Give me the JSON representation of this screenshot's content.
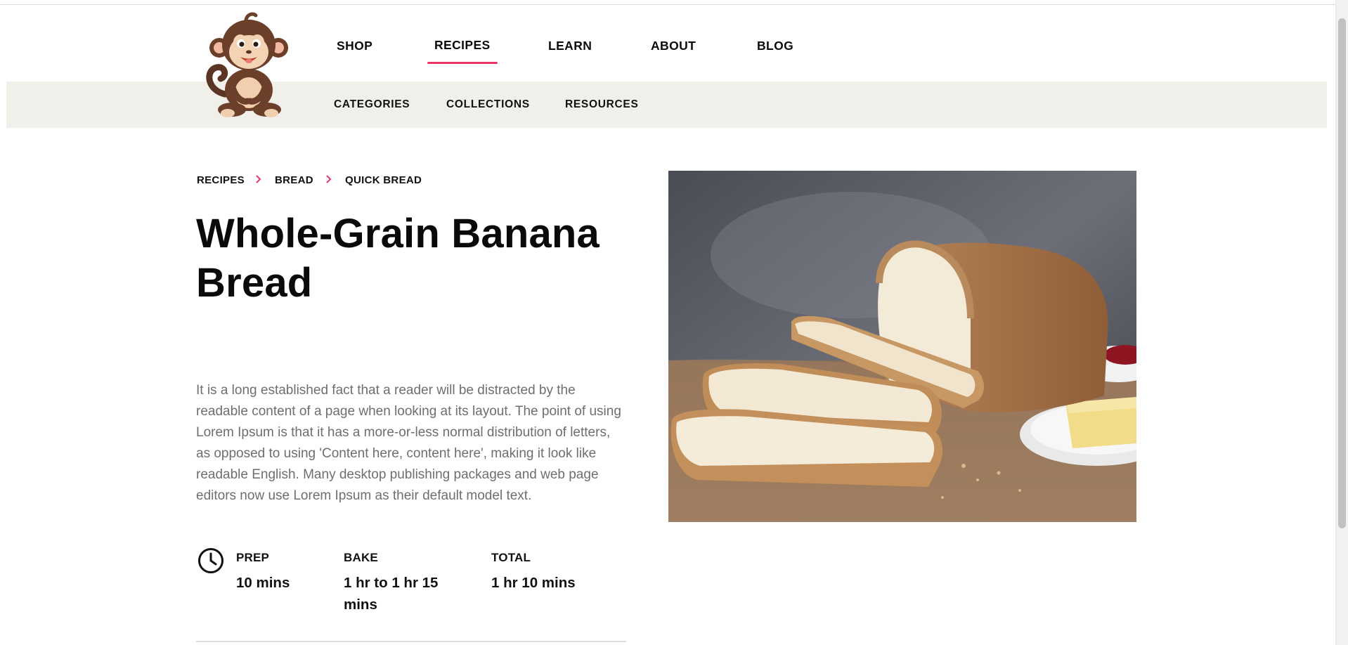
{
  "main_nav": {
    "items": [
      {
        "label": "SHOP",
        "active": false
      },
      {
        "label": "RECIPES",
        "active": true
      },
      {
        "label": "LEARN",
        "active": false
      },
      {
        "label": "ABOUT",
        "active": false
      },
      {
        "label": "BLOG",
        "active": false
      }
    ]
  },
  "sub_nav": {
    "items": [
      {
        "label": "CATEGORIES"
      },
      {
        "label": "COLLECTIONS"
      },
      {
        "label": "RESOURCES"
      }
    ]
  },
  "breadcrumb": {
    "items": [
      {
        "label": "RECIPES"
      },
      {
        "label": "BREAD"
      },
      {
        "label": "QUICK BREAD"
      }
    ],
    "separator_icon": "chevron-right-icon"
  },
  "recipe": {
    "title": "Whole-Grain Banana Bread",
    "description": "It is a long established fact that a reader will be distracted by the readable content of a page when looking at its layout. The point of using Lorem Ipsum is that it has a more-or-less normal distribution of letters, as opposed to using 'Content here, content here', making it look like readable English. Many desktop publishing packages and web page editors now use Lorem Ipsum as their default model text.",
    "times": {
      "icon": "clock-icon",
      "prep": {
        "label": "PREP",
        "value": "10 mins"
      },
      "bake": {
        "label": "BAKE",
        "value": "1 hr to 1 hr 15 mins"
      },
      "total": {
        "label": "TOTAL",
        "value": "1 hr 10 mins"
      }
    }
  },
  "colors": {
    "accent": "#e8336b",
    "subnav_background": "#f0efe9",
    "body_text": "#6e6e6e"
  },
  "icons": {
    "logo": "monkey-logo",
    "hero": "bread-loaf-image"
  }
}
